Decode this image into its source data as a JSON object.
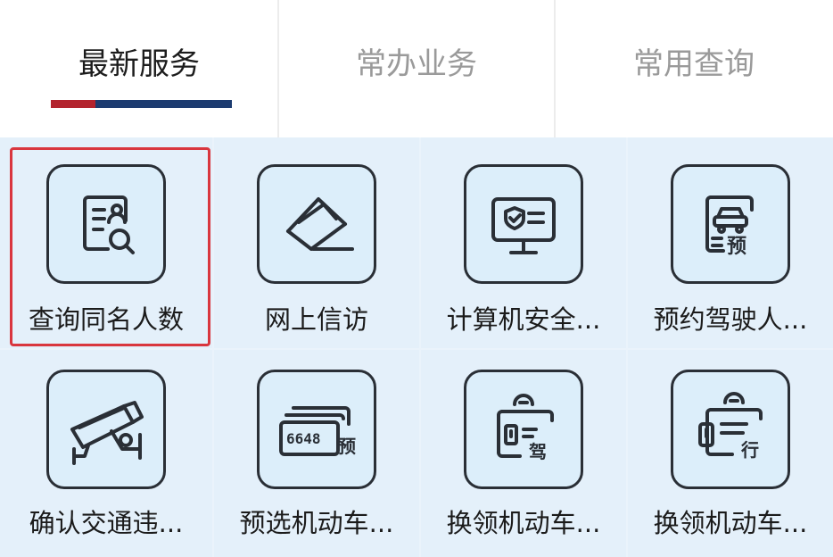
{
  "tabs": [
    {
      "label": "最新服务",
      "active": true
    },
    {
      "label": "常办业务",
      "active": false
    },
    {
      "label": "常用查询",
      "active": false
    }
  ],
  "colors": {
    "underline_red": "#b3242e",
    "underline_blue": "#1c3b70",
    "highlight": "#d9363e",
    "icon_stroke": "#2a2f36"
  },
  "services": [
    {
      "label": "查询同名人数",
      "icon": "id-card-search-icon",
      "highlighted": true
    },
    {
      "label": "网上信访",
      "icon": "envelope-pen-icon",
      "highlighted": false
    },
    {
      "label": "计算机安全...",
      "icon": "computer-shield-icon",
      "highlighted": false
    },
    {
      "label": "预约驾驶人...",
      "icon": "car-booking-icon",
      "highlighted": false
    },
    {
      "label": "确认交通违...",
      "icon": "surveillance-camera-icon",
      "highlighted": false
    },
    {
      "label": "预选机动车...",
      "icon": "license-plate-icon",
      "highlighted": false
    },
    {
      "label": "换领机动车...",
      "icon": "driving-license-renew-icon",
      "highlighted": false
    },
    {
      "label": "换领机动车...",
      "icon": "vehicle-license-renew-icon",
      "highlighted": false
    }
  ],
  "icon_text": {
    "plate_number": "6648",
    "plate_char": "预",
    "car_char": "预",
    "drive_char": "驾",
    "license_char": "行"
  }
}
